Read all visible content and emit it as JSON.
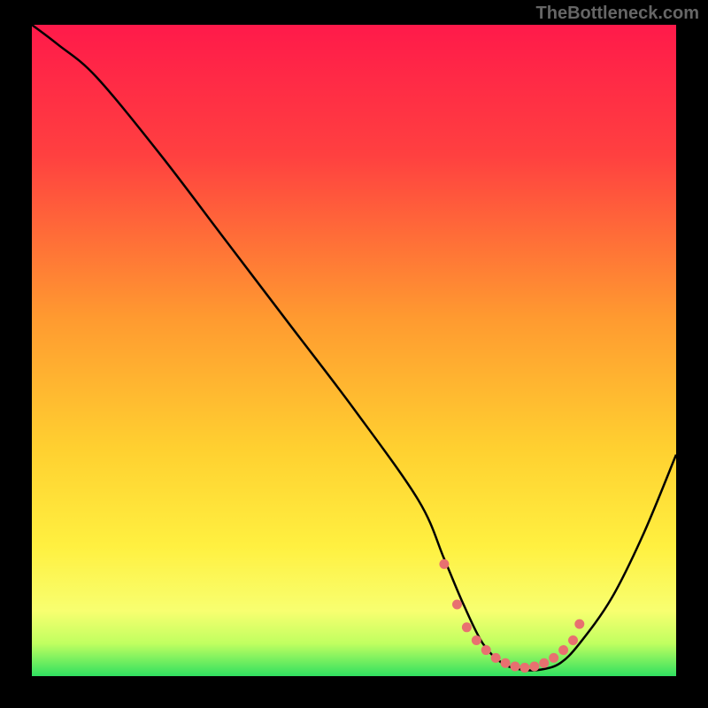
{
  "watermark": "TheBottleneck.com",
  "chart_data": {
    "type": "line",
    "title": "",
    "xlabel": "",
    "ylabel": "",
    "xlim": [
      0,
      100
    ],
    "ylim": [
      0,
      100
    ],
    "series": [
      {
        "name": "curve",
        "x": [
          0,
          4,
          10,
          20,
          30,
          40,
          50,
          60,
          64,
          67,
          70,
          73,
          76,
          79,
          82,
          85,
          90,
          95,
          100
        ],
        "y": [
          100,
          97,
          92,
          80,
          67,
          54,
          41,
          27,
          18,
          11,
          5,
          2,
          1,
          1,
          2,
          5,
          12,
          22,
          34
        ]
      }
    ],
    "markers": {
      "name": "dots",
      "x": [
        64,
        66,
        67.5,
        69,
        70.5,
        72,
        73.5,
        75,
        76.5,
        78,
        79.5,
        81,
        82.5,
        84,
        85
      ],
      "y": [
        17.2,
        11,
        7.5,
        5.5,
        4,
        2.8,
        2,
        1.5,
        1.3,
        1.5,
        2,
        2.8,
        4,
        5.5,
        8
      ]
    },
    "gradient_stops": [
      {
        "offset": 0,
        "color": "#ff1a4a"
      },
      {
        "offset": 20,
        "color": "#ff4040"
      },
      {
        "offset": 45,
        "color": "#ff9a30"
      },
      {
        "offset": 65,
        "color": "#ffd030"
      },
      {
        "offset": 80,
        "color": "#fff040"
      },
      {
        "offset": 90,
        "color": "#f8ff70"
      },
      {
        "offset": 95,
        "color": "#c0ff60"
      },
      {
        "offset": 100,
        "color": "#30e060"
      }
    ]
  }
}
